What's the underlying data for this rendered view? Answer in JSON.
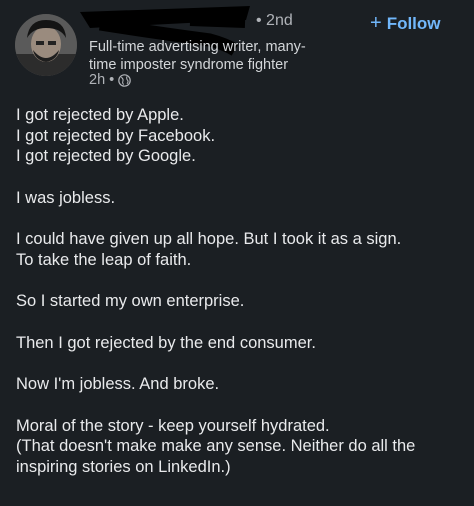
{
  "post": {
    "author_name": "",
    "connection_degree": "• 2nd",
    "follow_label": "Follow",
    "follow_icon": "plus-icon",
    "headline_lines": [
      "Full-time advertising writer, many-",
      "time imposter syndrome fighter"
    ],
    "timestamp": "2h •",
    "visibility_icon": "globe-icon",
    "body_paragraphs": [
      [
        "I got rejected by Apple.",
        "I got rejected by Facebook.",
        "I got rejected by Google."
      ],
      [
        "I was jobless."
      ],
      [
        "I could have given up all hope. But I took it as a sign.",
        "To take the leap of faith."
      ],
      [
        "So I started my own enterprise."
      ],
      [
        "Then I got rejected by the end consumer."
      ],
      [
        "Now I'm jobless. And broke."
      ],
      [
        "Moral of the story - keep yourself hydrated.",
        "(That doesn't make make any sense. Neither do all the",
        "inspiring stories on LinkedIn.)"
      ]
    ]
  },
  "colors": {
    "background": "#1b1f23",
    "text": "#e9eaec",
    "muted": "#b0b3b8",
    "accent": "#71b7fb"
  }
}
